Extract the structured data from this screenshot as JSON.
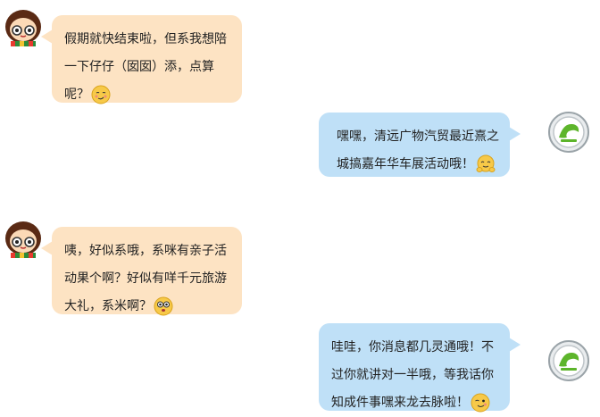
{
  "messages": [
    {
      "side": "left",
      "lines": [
        "假期就快结束啦，但系我想陪",
        "一下仔仔（囡囡）添，点算",
        "呢？"
      ],
      "emoji": "shy-smile-emoji"
    },
    {
      "side": "right",
      "lines": [
        "嘿嘿，清远广物汽贸最近熹之",
        "城搞嘉年华车展活动哦！"
      ],
      "emoji": "hug-emoji"
    },
    {
      "side": "left",
      "lines": [
        "咦，好似系哦，系咪有亲子活",
        "动果个啊？好似有咩千元旅游",
        "大礼，系米啊？"
      ],
      "emoji": "surprised-emoji"
    },
    {
      "side": "right",
      "lines": [
        "哇哇，你消息都几灵通哦！不",
        "过你就讲对一半哦，等我话你",
        "知成件事嘿来龙去脉啦！"
      ],
      "emoji": "wink-emoji"
    }
  ],
  "colors": {
    "left_bubble": "#fde3c3",
    "right_bubble": "#bfe0f7",
    "brand_green": "#5db52b"
  }
}
